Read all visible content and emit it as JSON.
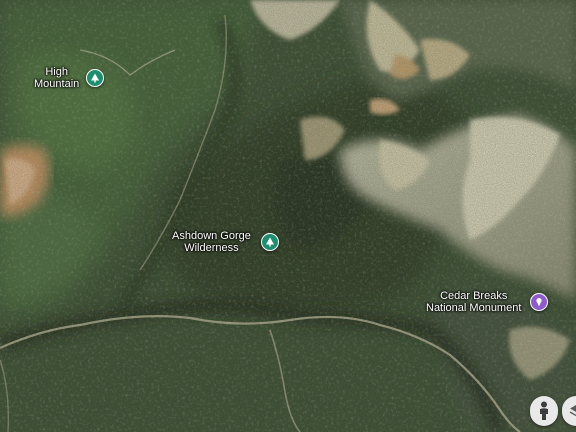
{
  "places": [
    {
      "name_line1": "High",
      "name_line2": "Mountain",
      "kind": "park",
      "icon": "tree-icon",
      "color": "#1e8e6e"
    },
    {
      "name_line1": "Ashdown Gorge",
      "name_line2": "Wilderness",
      "kind": "park",
      "icon": "tree-icon",
      "color": "#1e8e6e"
    },
    {
      "name_line1": "Cedar Breaks",
      "name_line2": "National Monument",
      "kind": "landmark",
      "icon": "landmark-pin-icon",
      "color": "#8e5cc8"
    }
  ],
  "controls": {
    "street_view_icon": "pegman-icon",
    "layers_icon": "layers-icon"
  },
  "colors": {
    "forest": "#2f4a2a",
    "rock": "#d6cbb2",
    "ridge_shadow": "#1c2718",
    "canyon": "#b7b29c"
  }
}
